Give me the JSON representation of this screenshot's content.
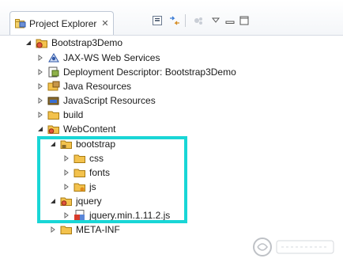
{
  "view": {
    "tab_label": "Project Explorer",
    "close_glyph": "✕",
    "toolbar": [
      "collapse-all-icon",
      "link-with-editor-icon",
      "focus-icon",
      "view-menu-icon",
      "minimize-icon",
      "maximize-icon"
    ]
  },
  "tree": {
    "project": "Bootstrap3Demo",
    "jaxws": "JAX-WS Web Services",
    "deployment": "Deployment Descriptor: Bootstrap3Demo",
    "java_resources": "Java Resources",
    "js_resources": "JavaScript Resources",
    "build": "build",
    "webcontent": "WebContent",
    "bootstrap": "bootstrap",
    "css": "css",
    "fonts": "fonts",
    "js": "js",
    "jquery": "jquery",
    "jquery_file": "jquery.min.1.11.2.js",
    "metainf": "META-INF"
  },
  "colors": {
    "highlight": "#19d6d6",
    "folder": "#f3c24d",
    "project": "#e2543a"
  }
}
